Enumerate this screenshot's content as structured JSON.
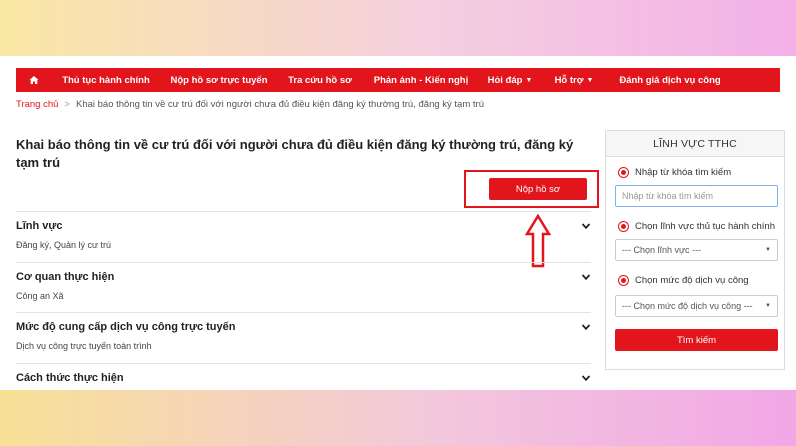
{
  "nav": {
    "items": [
      {
        "label": "Thủ tục hành chính",
        "dropdown": false
      },
      {
        "label": "Nộp hồ sơ trực tuyến",
        "dropdown": false
      },
      {
        "label": "Tra cứu hồ sơ",
        "dropdown": false
      },
      {
        "label": "Phản ánh - Kiến nghị",
        "dropdown": false
      },
      {
        "label": "Hỏi đáp",
        "dropdown": true
      },
      {
        "label": "Hỗ trợ",
        "dropdown": true
      },
      {
        "label": "Đánh giá dịch vụ công",
        "dropdown": false
      }
    ],
    "home_icon": "home-icon",
    "color": "#e1151b"
  },
  "breadcrumb": {
    "home": "Trang chủ",
    "separator": ">",
    "current": "Khai báo thông tin về cư trú đối với người chưa đủ điều kiện đăng ký thường trú, đăng ký tạm trú"
  },
  "page": {
    "title": "Khai báo thông tin về cư trú đối với người chưa đủ điều kiện đăng ký thường trú, đăng ký tạm trú",
    "submit_label": "Nộp hồ sơ"
  },
  "sections": [
    {
      "heading": "Lĩnh vực",
      "value": "Đăng ký, Quản lý cư trú"
    },
    {
      "heading": "Cơ quan thực hiện",
      "value": "Công an Xã"
    },
    {
      "heading": "Mức độ cung cấp dịch vụ công trực tuyến",
      "value": "Dịch vụ công trực tuyến toàn trình"
    },
    {
      "heading": "Cách thức thực hiện",
      "value": ""
    }
  ],
  "sidebar": {
    "title": "LĨNH VỰC TTHC",
    "keyword_label": "Nhập từ khóa tìm kiếm",
    "keyword_placeholder": "Nhập từ khóa tìm kiếm",
    "field_label": "Chọn lĩnh vực thủ tục hành chính",
    "field_select": "--- Chọn lĩnh vực ---",
    "level_label": "Chọn mức độ dịch vụ công",
    "level_select": "--- Chọn mức độ dịch vụ công ---",
    "search_label": "Tìm kiếm"
  }
}
